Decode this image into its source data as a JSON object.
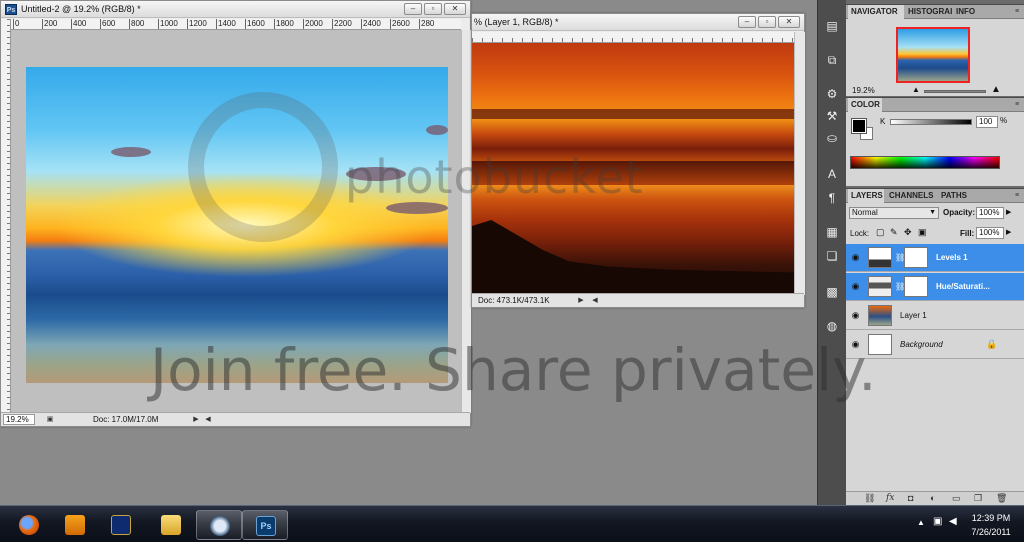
{
  "window_left": {
    "title": "Untitled-2 @ 19.2% (RGB/8) *",
    "ruler_ticks": [
      "0",
      "200",
      "400",
      "600",
      "800",
      "1000",
      "1200",
      "1400",
      "1600",
      "1800",
      "2000",
      "2200",
      "2400",
      "2600",
      "280"
    ],
    "zoom": "19.2%",
    "doc_info": "Doc: 17.0M/17.0M"
  },
  "window_right": {
    "title": "% (Layer 1, RGB/8) *",
    "doc_info": "Doc: 473.1K/473.1K"
  },
  "window_buttons": {
    "minimize": "–",
    "restore": "▫",
    "close": "✕"
  },
  "navigator_panel": {
    "tabs": [
      "NAVIGATOR",
      "HISTOGRAI",
      "INFO"
    ],
    "zoom": "19.2%"
  },
  "color_panel": {
    "tab": "COLOR",
    "channel_label": "K",
    "value": "100",
    "unit": "%"
  },
  "layers_panel": {
    "tabs": [
      "LAYERS",
      "CHANNELS",
      "PATHS"
    ],
    "blend_mode": "Normal",
    "opacity_label": "Opacity:",
    "opacity_value": "100%",
    "lock_label": "Lock:",
    "fill_label": "Fill:",
    "fill_value": "100%",
    "layers": [
      {
        "name": "Levels 1",
        "selected": true
      },
      {
        "name": "Hue/Saturati...",
        "selected": true
      },
      {
        "name": "Layer 1",
        "selected": false
      },
      {
        "name": "Background",
        "selected": false
      }
    ],
    "bottom_icons": [
      "link-icon",
      "fx-icon",
      "mask-icon",
      "adjustment-icon",
      "folder-icon",
      "new-layer-icon",
      "trash-icon"
    ]
  },
  "watermark": {
    "logo_text": "photobucket",
    "tagline": "Join free. Share privately."
  },
  "taskbar": {
    "apps": [
      "firefox",
      "media-player",
      "league-launcher",
      "file-explorer",
      "steam-headset",
      "photoshop"
    ],
    "time": "12:39 PM",
    "date": "7/26/2011"
  }
}
